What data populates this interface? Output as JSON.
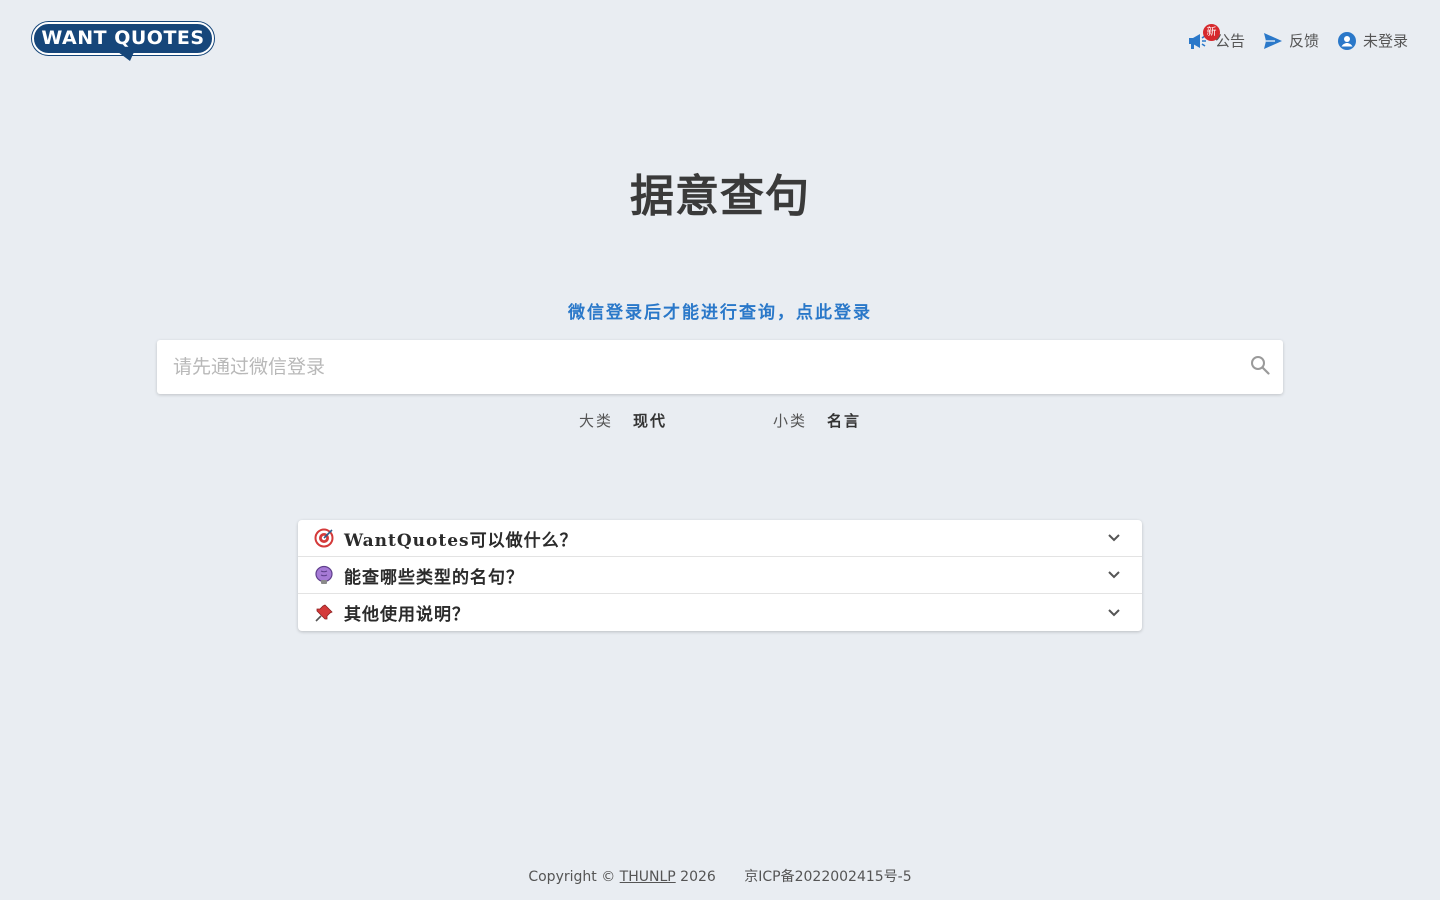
{
  "header": {
    "logo_text": "WANT QUOTES",
    "nav": {
      "announcement": {
        "label": "公告",
        "badge": "新"
      },
      "feedback": {
        "label": "反馈"
      },
      "account": {
        "label": "未登录"
      }
    }
  },
  "main": {
    "title": "据意查句",
    "login_hint": "微信登录后才能进行查询，点此登录",
    "search": {
      "placeholder": "请先通过微信登录",
      "value": ""
    },
    "categories": [
      {
        "label": "大类",
        "value": "现代"
      },
      {
        "label": "小类",
        "value": "名言"
      }
    ]
  },
  "faq": [
    {
      "icon": "target-icon",
      "text": "WantQuotes可以做什么？"
    },
    {
      "icon": "brain-icon",
      "text": "能查哪些类型的名句？"
    },
    {
      "icon": "pushpin-icon",
      "text": "其他使用说明？"
    }
  ],
  "footer": {
    "copyright_prefix": "Copyright ©",
    "org": "THUNLP",
    "year": "2026",
    "icp": "京ICP备2022002415号-5"
  },
  "colors": {
    "background": "#e9edf2",
    "accent": "#2a78c9",
    "logo_bg": "#16467a",
    "badge": "#d6292d"
  }
}
